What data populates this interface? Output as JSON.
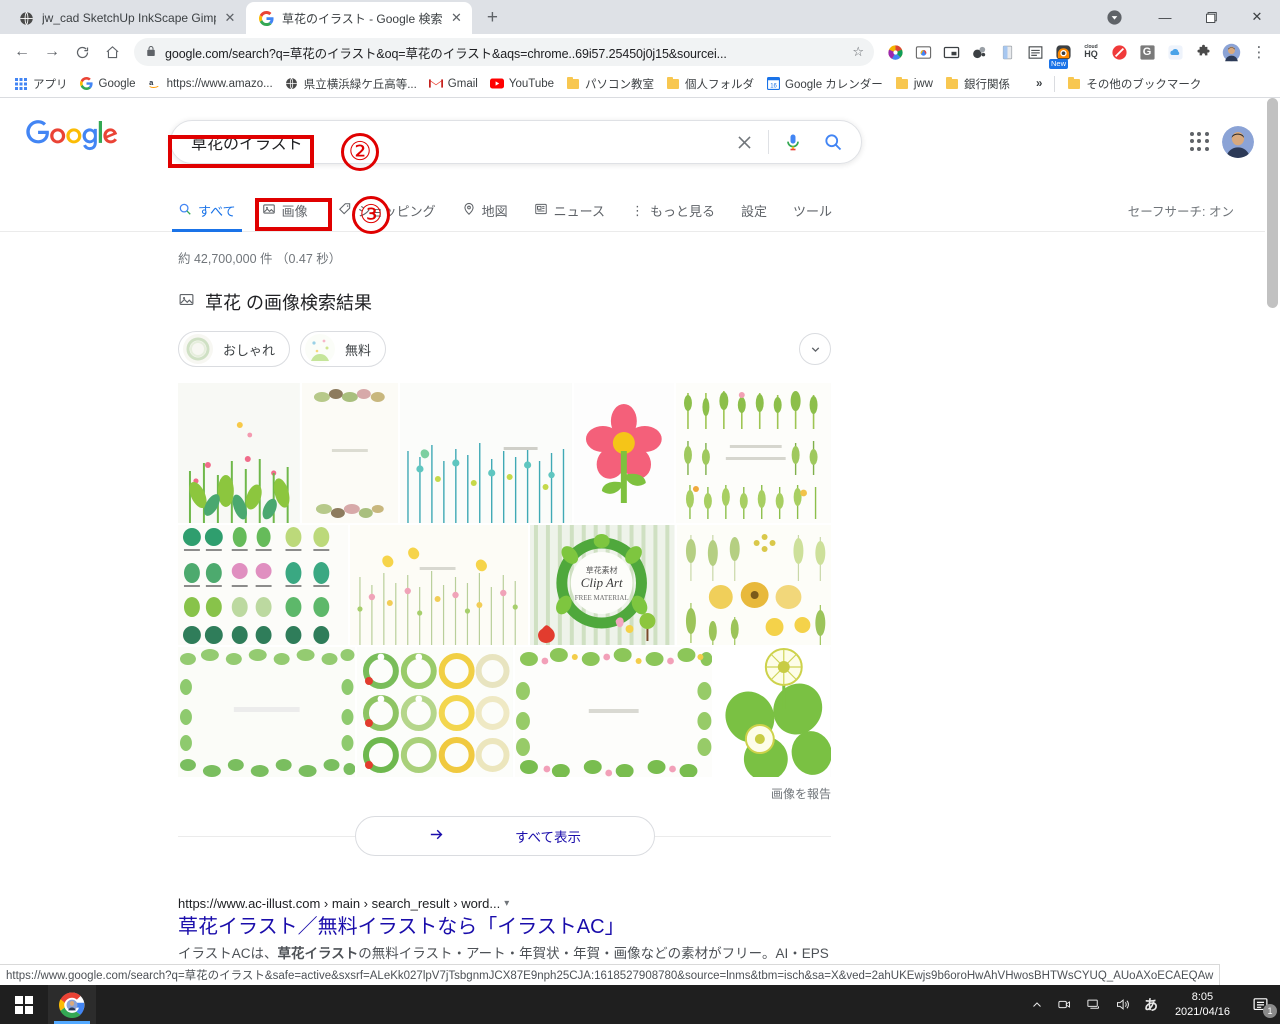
{
  "window": {
    "tabs": [
      {
        "title": "jw_cad SketchUp InkScape Gimp",
        "favicon": "globe-icon",
        "active": false
      },
      {
        "title": "草花のイラスト - Google 検索",
        "favicon": "google-icon",
        "active": true
      }
    ],
    "new_tab_label": "+",
    "controls": {
      "minimize": "—",
      "maximize": "▣",
      "close": "✕"
    }
  },
  "toolbar": {
    "back": "←",
    "forward": "→",
    "reload": "C",
    "home": "⌂",
    "url": "google.com/search?q=草花のイラスト&oq=草花のイラスト&aqs=chrome..69i57.25450j0j15&sourcei...",
    "lock_icon": "lock-icon",
    "star_icon": "star-icon",
    "extensions": [
      "color-wheel-icon",
      "screenshot-icon",
      "picture-in-picture-icon",
      "bubbles-icon",
      "blue-page-icon",
      "list-icon",
      "camera-new-icon",
      "cloudhq-icon",
      "block-icon",
      "grammarly-icon",
      "cloud-icon",
      "puzzle-icon"
    ],
    "new_badge": "New",
    "cloudhq_top": "cloud",
    "cloudhq_bottom": "HQ",
    "grammarly_letter": "G",
    "menu": "⋮"
  },
  "bookmarks": {
    "items": [
      {
        "label": "アプリ",
        "icon": "apps-grid-icon"
      },
      {
        "label": "Google",
        "icon": "google-icon"
      },
      {
        "label": "https://www.amazo...",
        "icon": "amazon-icon"
      },
      {
        "label": "県立横浜緑ケ丘高等...",
        "icon": "globe-icon"
      },
      {
        "label": "Gmail",
        "icon": "gmail-icon"
      },
      {
        "label": "YouTube",
        "icon": "youtube-icon"
      },
      {
        "label": "パソコン教室",
        "icon": "folder-icon"
      },
      {
        "label": "個人フォルダ",
        "icon": "folder-icon"
      },
      {
        "label": "Google カレンダー",
        "icon": "calendar-icon"
      },
      {
        "label": "jww",
        "icon": "folder-icon"
      },
      {
        "label": "銀行関係",
        "icon": "folder-icon"
      }
    ],
    "overflow": "»",
    "other": {
      "label": "その他のブックマーク",
      "icon": "folder-icon"
    }
  },
  "search": {
    "logo": "google-logo",
    "query": "草花のイラスト",
    "clear_icon": "close-icon",
    "mic_icon": "microphone-icon",
    "search_icon": "search-icon",
    "apps_icon": "apps-grid-icon",
    "avatar": "user-avatar"
  },
  "nav_tabs": [
    {
      "label": "すべて",
      "icon": "search-icon",
      "selected": true
    },
    {
      "label": "画像",
      "icon": "image-icon",
      "selected": false
    },
    {
      "label": "ショッピング",
      "icon": "tag-icon",
      "selected": false
    },
    {
      "label": "地図",
      "icon": "location-pin-icon",
      "selected": false
    },
    {
      "label": "ニュース",
      "icon": "news-icon",
      "selected": false
    },
    {
      "label": "もっと見る",
      "icon": "more-vertical-icon",
      "selected": false
    },
    {
      "label": "設定",
      "icon": "",
      "selected": false
    },
    {
      "label": "ツール",
      "icon": "",
      "selected": false
    }
  ],
  "safesearch_label": "セーフサーチ: オン",
  "results": {
    "stats": "約 42,700,000 件 （0.47 秒）",
    "image_section_title": "草花 の画像検索結果",
    "image_section_icon": "image-icon",
    "chips": [
      {
        "label": "おしゃれ",
        "thumb": "thumb-oshare"
      },
      {
        "label": "無料",
        "thumb": "thumb-muryo"
      }
    ],
    "chips_expand_icon": "chevron-down-icon",
    "report_images": "画像を報告",
    "show_all": "すべて表示",
    "show_all_icon": "arrow-right-icon",
    "web_result": {
      "url": "https://www.ac-illust.com › main › search_result › word...",
      "url_caret": "▾",
      "title": "草花イラスト／無料イラストなら「イラストAC」",
      "snippet_1": "イラストACは、",
      "snippet_bold": "草花イラスト",
      "snippet_2": "の無料イラスト・アート・年賀状・年賀・画像などの素材がフリー。AI・EPS形式の素材も無料でダウンロードOK！商用利用、編集もOK。かわいいフリーイラストも豊富！"
    }
  },
  "status_url": "https://www.google.com/search?q=草花のイラスト&safe=active&sxsrf=ALeKk027lpV7jTsbgnmJCX87E9nph25CJA:1618527908780&source=lnms&tbm=isch&sa=X&ved=2ahUKEwjs9b6oroHwAhVHwosBHTWsCYUQ_AUoAXoECAEQAw",
  "annotations": [
    {
      "id": "ann-2",
      "shape": "circle",
      "label": "②"
    },
    {
      "id": "ann-3",
      "shape": "circle",
      "label": "③"
    }
  ],
  "taskbar": {
    "start_icon": "windows-start-icon",
    "apps": [
      {
        "name": "chrome-taskbar-icon"
      }
    ],
    "tray": [
      {
        "icon": "chevron-up-icon",
        "glyph": "ᐱ"
      },
      {
        "icon": "meet-camera-icon",
        "glyph": "▭"
      },
      {
        "icon": "network-icon",
        "glyph": "🖳"
      },
      {
        "icon": "volume-icon",
        "glyph": "🔊"
      },
      {
        "icon": "ime-icon",
        "glyph": "あ"
      }
    ],
    "time": "8:05",
    "date": "2021/04/16",
    "notification_icon": "notification-icon",
    "notification_count": "1"
  },
  "colors": {
    "accent_blue": "#1a73e8",
    "link_blue": "#1a0dab",
    "annotation_red": "#e00000",
    "chrome_tabstrip": "#dee1e6",
    "taskbar": "#1f1f1f"
  }
}
